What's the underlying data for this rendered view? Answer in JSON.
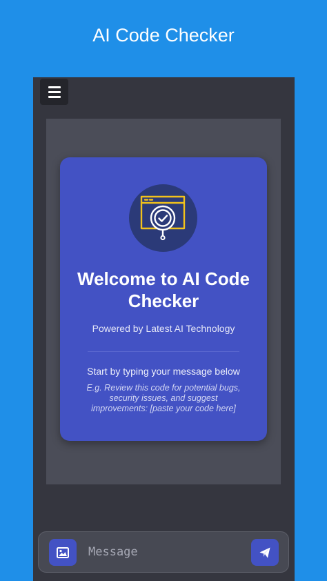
{
  "app": {
    "title": "AI Code Checker"
  },
  "header": {
    "menu_icon": "hamburger-icon"
  },
  "welcome": {
    "logo_icon": "code-check-icon",
    "title": "Welcome to AI Code Checker",
    "subtitle": "Powered by Latest AI Technology",
    "start_text": "Start by typing your message below",
    "example": "E.g. Review this code for potential bugs, security issues, and suggest improvements: [paste your code here]"
  },
  "composer": {
    "image_icon": "image-icon",
    "placeholder": "Message",
    "value": "",
    "send_icon": "send-icon"
  },
  "colors": {
    "background": "#1f8fe8",
    "device": "#35363f",
    "chat_area": "#4b4d58",
    "card": "#4352c4",
    "logo_circle": "#2b3a78",
    "logo_accent": "#f2c21b",
    "button": "#4352c4"
  }
}
